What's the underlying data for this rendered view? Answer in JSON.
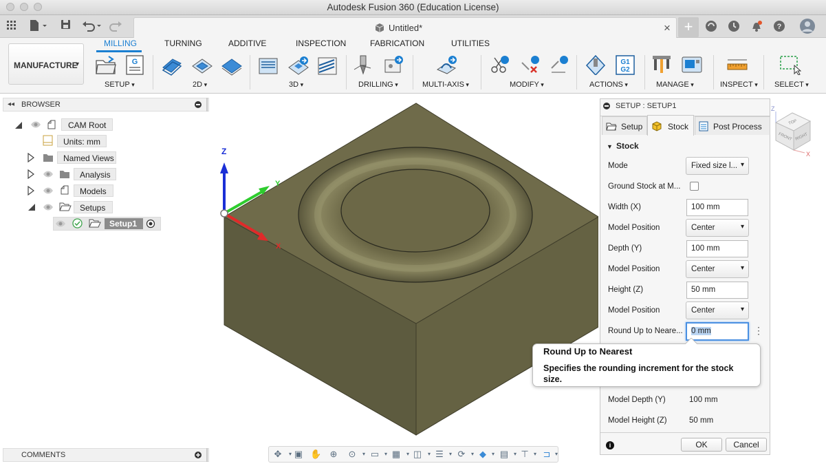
{
  "window": {
    "title": "Autodesk Fusion 360 (Education License)"
  },
  "document_tab": {
    "title": "Untitled*",
    "close_glyph": "×",
    "add_glyph": "+"
  },
  "workspace": {
    "label": "MANUFACTURE"
  },
  "ribbon": {
    "tabs": [
      {
        "label": "MILLING",
        "active": true
      },
      {
        "label": "TURNING",
        "active": false
      },
      {
        "label": "ADDITIVE",
        "active": false
      },
      {
        "label": "INSPECTION",
        "active": false
      },
      {
        "label": "FABRICATION",
        "active": false
      },
      {
        "label": "UTILITIES",
        "active": false
      }
    ],
    "groups": [
      "SETUP",
      "2D",
      "3D",
      "DRILLING",
      "MULTI-AXIS",
      "MODIFY",
      "ACTIONS",
      "MANAGE",
      "INSPECT",
      "SELECT"
    ],
    "g1g2_text": [
      "G1",
      "G2"
    ],
    "g_text": "G"
  },
  "browser": {
    "title": "BROWSER",
    "nodes": [
      {
        "label": "CAM Root"
      },
      {
        "label": "Units: mm"
      },
      {
        "label": "Named Views"
      },
      {
        "label": "Analysis"
      },
      {
        "label": "Models"
      },
      {
        "label": "Setups"
      },
      {
        "label": "Setup1"
      }
    ]
  },
  "comments": {
    "title": "COMMENTS"
  },
  "axes": {
    "z": "Z",
    "y": "Y",
    "x": "X"
  },
  "viewcube": {
    "top": "TOP",
    "front": "FRONT",
    "right": "RIGHT",
    "z": "Z",
    "x": "X"
  },
  "panel": {
    "title": "SETUP : SETUP1",
    "tabs": [
      {
        "label": "Setup"
      },
      {
        "label": "Stock"
      },
      {
        "label": "Post Process"
      }
    ],
    "section": "Stock",
    "fields": {
      "mode": {
        "label": "Mode",
        "value": "Fixed size l..."
      },
      "ground": {
        "label": "Ground Stock at M..."
      },
      "width": {
        "label": "Width (X)",
        "value": "100 mm"
      },
      "pos_x": {
        "label": "Model Position",
        "value": "Center"
      },
      "depth": {
        "label": "Depth (Y)",
        "value": "100 mm"
      },
      "pos_y": {
        "label": "Model Position",
        "value": "Center"
      },
      "height": {
        "label": "Height (Z)",
        "value": "50 mm"
      },
      "pos_z": {
        "label": "Model Position",
        "value": "Center"
      },
      "round": {
        "label": "Round Up to Neare...",
        "value": "0 mm"
      },
      "model_depth": {
        "label": "Model Depth (Y)",
        "value": "100 mm"
      },
      "model_height": {
        "label": "Model Height (Z)",
        "value": "50 mm"
      }
    },
    "ok": "OK",
    "cancel": "Cancel",
    "info_glyph": "i"
  },
  "tooltip": {
    "title": "Round Up to Nearest",
    "body": "Specifies the rounding increment for the stock size."
  },
  "colors": {
    "accent": "#1b7fd1",
    "stock_top": "#6f6b4a",
    "stock_left": "#5d5b3f",
    "stock_right": "#656243"
  }
}
